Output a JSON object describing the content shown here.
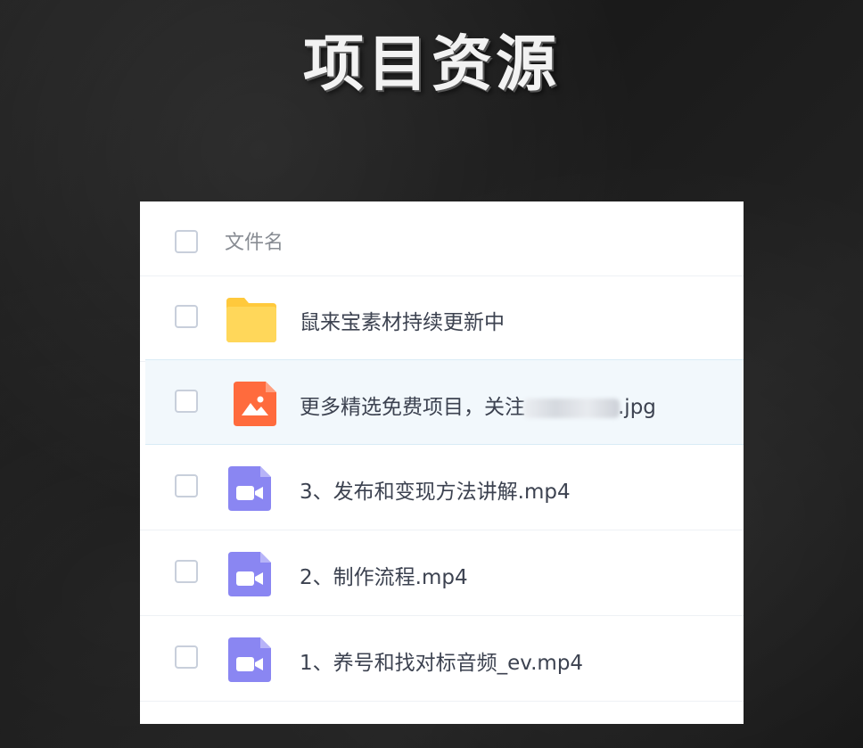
{
  "page": {
    "title": "项目资源"
  },
  "file_list": {
    "header": {
      "column_label": "文件名"
    },
    "items": [
      {
        "name": "鼠来宝素材持续更新中",
        "type": "folder",
        "icon": "folder-icon"
      },
      {
        "name_prefix": "更多精选免费项目，关注",
        "name_suffix": ".jpg",
        "type": "image",
        "icon": "image-file-icon",
        "redacted": true
      },
      {
        "name": "3、发布和变现方法讲解.mp4",
        "type": "video",
        "icon": "video-file-icon"
      },
      {
        "name": "2、制作流程.mp4",
        "type": "video",
        "icon": "video-file-icon"
      },
      {
        "name": "1、养号和找对标音频_ev.mp4",
        "type": "video",
        "icon": "video-file-icon"
      }
    ]
  },
  "colors": {
    "folder": "#FFD34F",
    "image_icon": "#FF6B3D",
    "video_icon": "#8A86F2",
    "selected_row": "#F2F8FC"
  }
}
